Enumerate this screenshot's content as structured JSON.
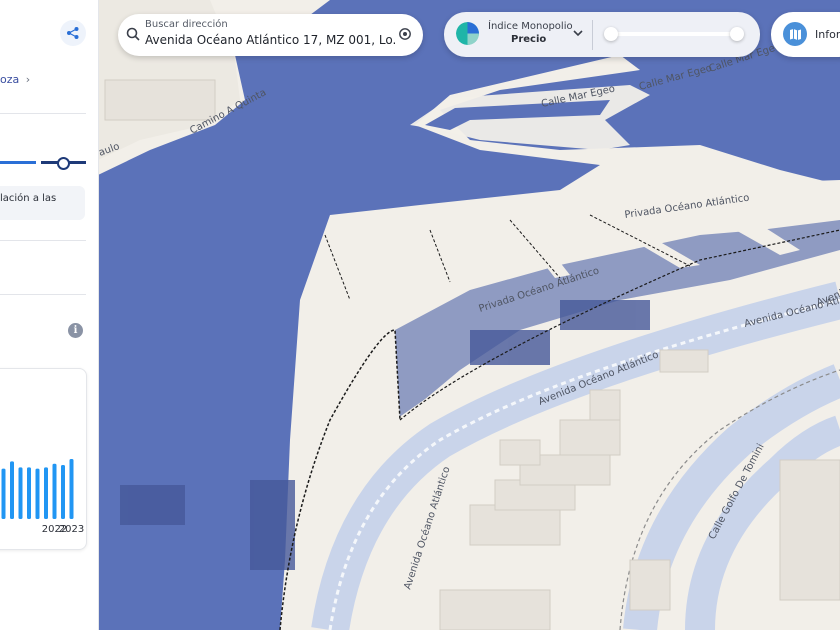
{
  "sidebar": {
    "crumb": "oza",
    "note": "lación a las",
    "chart_card": {
      "chart_data": {
        "type": "bar",
        "categories": [
          "",
          "",
          "",
          "",
          "",
          "",
          "",
          "2022",
          "",
          "2023"
        ],
        "values": [
          76,
          84,
          96,
          86,
          86,
          84,
          86,
          92,
          90,
          100
        ],
        "title": "",
        "xlabel": "",
        "ylabel": "",
        "ylim": [
          0,
          100
        ]
      }
    }
  },
  "search": {
    "label": "Buscar dirección",
    "value": "Avenida Océano Atlántico 17, MZ 001, Lo..."
  },
  "index_control": {
    "label": "Índice Monopolio",
    "value": "Precio",
    "range": [
      0.05,
      0.95
    ]
  },
  "info_button": {
    "label": "Inform"
  },
  "map": {
    "streets": [
      "Calle Mar Egeo",
      "Calle Mar Egeo",
      "Calle Mar Egeo",
      "Privada Océano Atlántico",
      "Privada Océano Atlántico",
      "Avenida Océano Atlántico",
      "Avenida Océano Atlántico",
      "Avenida Océano Atlántico",
      "Avenida Océano Atlántico",
      "Calle Golfo De Tomini",
      "Camino A Quinta",
      "aulo"
    ]
  },
  "colors": {
    "water": "#5b72b9",
    "accent": "#2a6fd6",
    "dark": "#1e3a78",
    "land": "#f2efe9"
  }
}
